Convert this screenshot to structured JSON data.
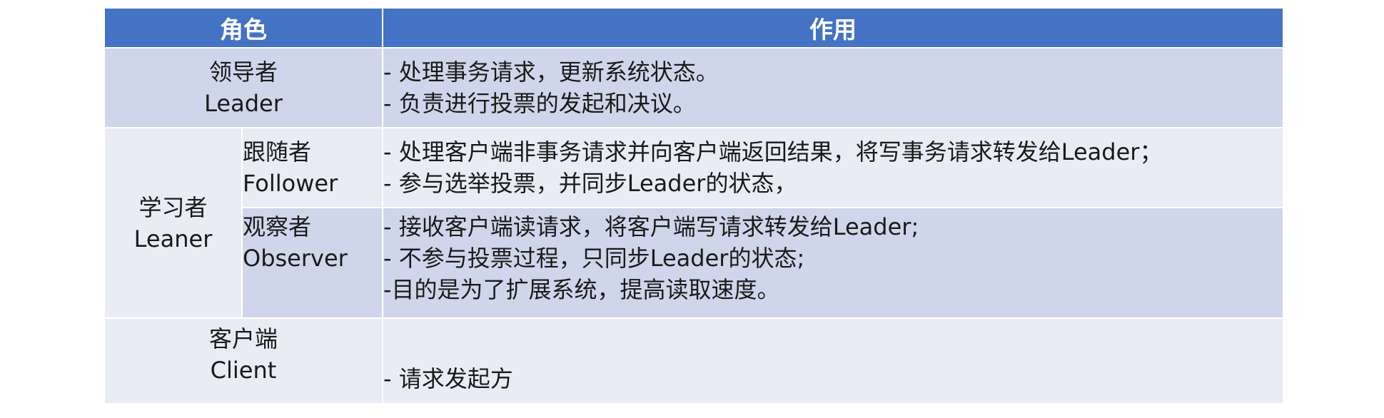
{
  "header": {
    "role": "角色",
    "function": "作用"
  },
  "rows": {
    "leader": {
      "name_cn": "领导者",
      "name_en": "Leader",
      "desc": [
        "- 处理事务请求，更新系统状态。",
        "- 负责进行投票的发起和决议。"
      ]
    },
    "learner": {
      "name_cn": "学习者",
      "name_en": "Leaner",
      "follower": {
        "name_cn": "跟随者",
        "name_en": "Follower",
        "desc": [
          "- 处理客户端非事务请求并向客户端返回结果，将写事务请求转发给Leader；",
          "- 参与选举投票，并同步Leader的状态，"
        ]
      },
      "observer": {
        "name_cn": "观察者",
        "name_en": "Observer",
        "desc": [
          "- 接收客户端读请求，将客户端写请求转发给Leader;",
          "- 不参与投票过程，只同步Leader的状态;",
          "-目的是为了扩展系统，提高读取速度。"
        ]
      }
    },
    "client": {
      "name_cn": "客户端",
      "name_en": "Client",
      "desc": [
        "- 请求发起方"
      ]
    }
  },
  "colors": {
    "header_bg": "#4472c4",
    "row_dark": "#cfd5ea",
    "row_light": "#e9ebf5"
  }
}
